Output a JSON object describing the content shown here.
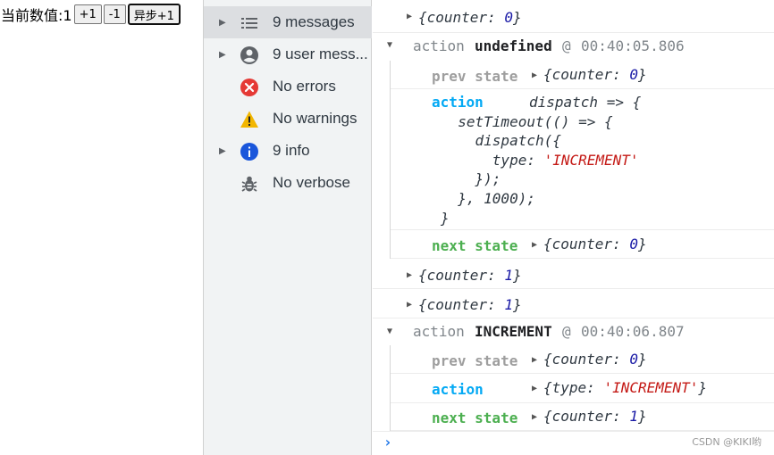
{
  "app": {
    "label": "当前数值:1",
    "buttons": [
      "+1",
      "-1",
      "异步+1"
    ]
  },
  "sidebar": {
    "items": [
      {
        "label": "9 messages",
        "icon": "list-icon"
      },
      {
        "label": "9 user mess...",
        "icon": "user-icon"
      },
      {
        "label": "No errors",
        "icon": "error-icon"
      },
      {
        "label": "No warnings",
        "icon": "warning-icon"
      },
      {
        "label": "9 info",
        "icon": "info-icon"
      },
      {
        "label": "No verbose",
        "icon": "bug-icon"
      }
    ]
  },
  "console": {
    "obj_open": "{counter: ",
    "obj_close": "}",
    "log1_val": "0",
    "group1": {
      "action_word": "action",
      "type": "undefined",
      "at": "@",
      "time": "00:40:05.806",
      "prev_label": "prev state",
      "prev_val": "0",
      "action_label": "action",
      "code": [
        "dispatch => {",
        "  setTimeout(() => {",
        "    dispatch({",
        "      type: 'INCREMENT'",
        "    });",
        "  }, 1000);",
        "}"
      ],
      "next_label": "next state",
      "next_val": "0"
    },
    "log2_val": "1",
    "log3_val": "1",
    "group2": {
      "action_word": "action",
      "type": "INCREMENT",
      "at": "@",
      "time": "00:40:06.807",
      "prev_label": "prev state",
      "prev_val": "0",
      "action_label": "action",
      "action_obj_open": "{type: ",
      "action_obj_val": "'INCREMENT'",
      "next_label": "next state",
      "next_val": "1"
    },
    "prompt": "›"
  },
  "watermark": "CSDN @KIKI哟"
}
